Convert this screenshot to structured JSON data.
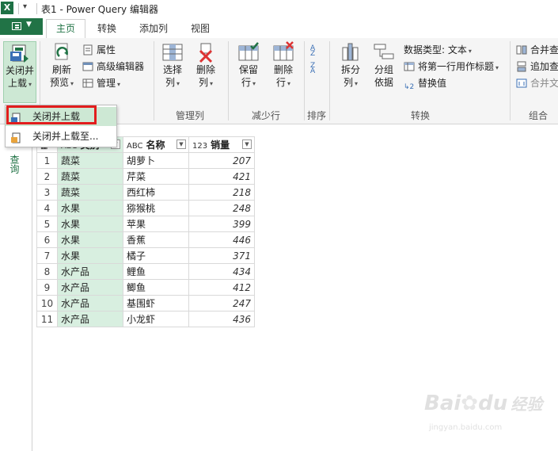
{
  "titlebar": {
    "app_icon": "excel-icon",
    "title": "表1 - Power Query 编辑器"
  },
  "tabs": [
    {
      "label": "主页",
      "active": true
    },
    {
      "label": "转换",
      "active": false
    },
    {
      "label": "添加列",
      "active": false
    },
    {
      "label": "视图",
      "active": false
    }
  ],
  "ribbon": {
    "close_load": {
      "line1": "关闭并",
      "line2": "上载"
    },
    "refresh": {
      "line1": "刷新",
      "line2": "预览"
    },
    "properties": "属性",
    "advanced_editor": "高级编辑器",
    "manage": "管理",
    "choose_cols": {
      "line1": "选择",
      "line2": "列"
    },
    "remove_cols": {
      "line1": "删除",
      "line2": "列"
    },
    "keep_rows": {
      "line1": "保留",
      "line2": "行"
    },
    "remove_rows": {
      "line1": "删除",
      "line2": "行"
    },
    "sort_label": "排序",
    "split_col": {
      "line1": "拆分",
      "line2": "列"
    },
    "group_by": {
      "line1": "分组",
      "line2": "依据"
    },
    "data_type": "数据类型: 文本",
    "first_row_header": "将第一行用作标题",
    "replace_values": "替换值",
    "merge_queries": "合并查",
    "append_queries": "追加查",
    "combine_files": "合并文",
    "groups": {
      "manage_cols": "管理列",
      "reduce_rows": "减少行",
      "sort": "排序",
      "transform": "转换",
      "combine": "组合"
    }
  },
  "menu": {
    "items": [
      {
        "label": "关闭并上载",
        "highlighted": true
      },
      {
        "label": "关闭并上载至..."
      }
    ]
  },
  "left_pane": {
    "label": "查询"
  },
  "table": {
    "columns": [
      {
        "type_icon": "ABC",
        "name": "类别"
      },
      {
        "type_icon": "ABC",
        "name": "名称"
      },
      {
        "type_icon": "123",
        "name": "销量"
      }
    ],
    "rows": [
      {
        "n": "1",
        "cat": "蔬菜",
        "name": "胡萝卜",
        "sales": "207"
      },
      {
        "n": "2",
        "cat": "蔬菜",
        "name": "芹菜",
        "sales": "421"
      },
      {
        "n": "3",
        "cat": "蔬菜",
        "name": "西红柿",
        "sales": "218"
      },
      {
        "n": "4",
        "cat": "水果",
        "name": "猕猴桃",
        "sales": "248"
      },
      {
        "n": "5",
        "cat": "水果",
        "name": "苹果",
        "sales": "399"
      },
      {
        "n": "6",
        "cat": "水果",
        "name": "香蕉",
        "sales": "446"
      },
      {
        "n": "7",
        "cat": "水果",
        "name": "橘子",
        "sales": "371"
      },
      {
        "n": "8",
        "cat": "水产品",
        "name": "鲤鱼",
        "sales": "434"
      },
      {
        "n": "9",
        "cat": "水产品",
        "name": "鲫鱼",
        "sales": "412"
      },
      {
        "n": "10",
        "cat": "水产品",
        "name": "基围虾",
        "sales": "247"
      },
      {
        "n": "11",
        "cat": "水产品",
        "name": "小龙虾",
        "sales": "436"
      }
    ]
  },
  "watermark": {
    "brand": "Bai",
    "brand2": "du",
    "cn": "经验",
    "url": "jingyan.baidu.com"
  },
  "colors": {
    "accent": "#217346",
    "highlight": "#cde8d4",
    "callout": "#e21d1d",
    "selected_col": "#d8efe0"
  }
}
